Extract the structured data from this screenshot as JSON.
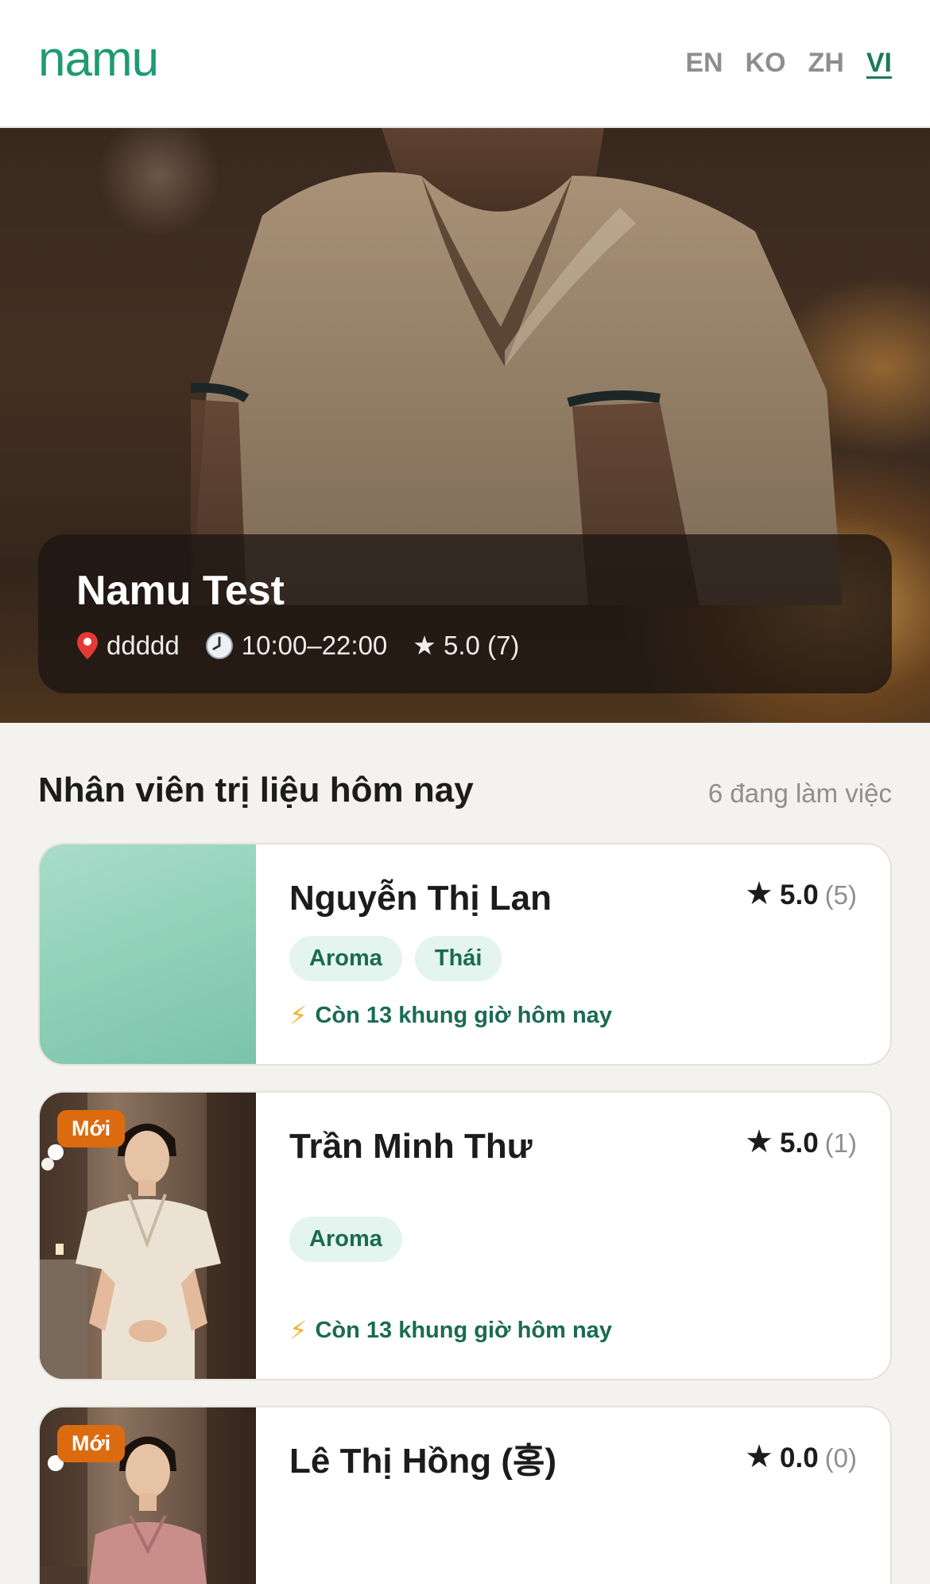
{
  "header": {
    "logo": "namu",
    "languages": [
      {
        "code": "EN",
        "active": false
      },
      {
        "code": "KO",
        "active": false
      },
      {
        "code": "ZH",
        "active": false
      },
      {
        "code": "VI",
        "active": true
      }
    ]
  },
  "shop": {
    "name": "Namu Test",
    "location_icon": "pin-icon",
    "location": "ddddd",
    "hours_icon": "clock-icon",
    "hours": "10:00–22:00",
    "rating_label": "★ 5.0 (7)"
  },
  "section": {
    "title": "Nhân viên trị liệu hôm nay",
    "count": "6 đang làm việc"
  },
  "therapists": [
    {
      "name": "Nguyễn Thị Lan",
      "rating": "5.0",
      "rating_count": "(5)",
      "tags": [
        "Aroma",
        "Thái"
      ],
      "slots": "Còn 13 khung giờ hôm nay",
      "badge": "",
      "photo": "placeholder"
    },
    {
      "name": "Trần Minh Thư",
      "rating": "5.0",
      "rating_count": "(1)",
      "tags": [
        "Aroma"
      ],
      "slots": "Còn 13 khung giờ hôm nay",
      "badge": "Mới",
      "photo": "portrait"
    },
    {
      "name": "Lê Thị Hồng (홍)",
      "rating": "0.0",
      "rating_count": "(0)",
      "tags": [],
      "slots": "",
      "badge": "Mới",
      "photo": "portrait"
    }
  ],
  "colors": {
    "brand": "#1f9a73",
    "tag_bg": "#e4f4ee",
    "tag_text": "#1a6b52",
    "badge": "#dc6b10",
    "background": "#f4f2ef"
  }
}
